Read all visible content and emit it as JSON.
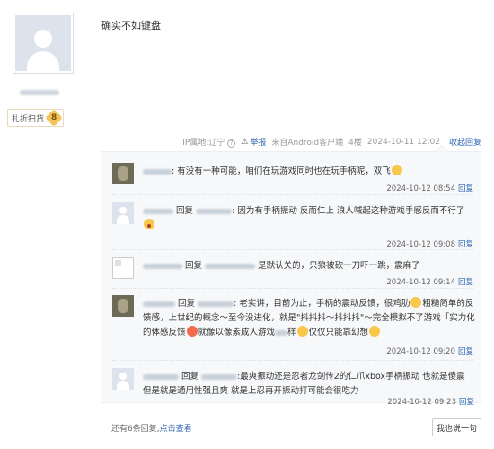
{
  "user": {
    "level_name": "扎折扫货",
    "level_number": "8"
  },
  "post": {
    "text": "确实不如键盘",
    "ip_label": "IP属地:辽宁",
    "report_label": "举报",
    "source_label": "来自Android客户端",
    "floor": "4楼",
    "datetime": "2024-10-11 12:02",
    "collapse_label": "收起回复"
  },
  "replies": [
    {
      "reply_to": "",
      "text": "有没有一种可能，咱们在玩游戏同时也在玩手柄呢，双飞",
      "time": "2024-10-12 08:54",
      "reply_label": "回复"
    },
    {
      "reply_to_prefix": "回复",
      "text": "因为有手柄振动 反而仁上 浪人喊起这种游戏手感反而不行了",
      "time": "2024-10-12 09:08",
      "reply_label": "回复"
    },
    {
      "reply_to_prefix": "回复",
      "text": "是默认关的，只狼被砍一刀吓一跳，震麻了",
      "time": "2024-10-12 09:14",
      "reply_label": "回复"
    },
    {
      "reply_to_prefix": "回复",
      "text_a": "老实讲，目前为止，手柄的震动反馈，很鸡肋",
      "text_b": "粗糙简单的反馈感，上世纪的概念～至今没进化，就是\"抖抖抖～抖抖抖\"～完全模拟不了游戏「实力化的体感反馈",
      "text_c": "就像以像素成人游戏",
      "text_d": "样",
      "text_e": "仅仅只能靠幻想",
      "time": "2024-10-12 09:20",
      "reply_label": "回复"
    },
    {
      "reply_to_prefix": "回复",
      "text": ":最爽振动还是忍者龙剑传2的仁爪xbox手柄振动 也就是傻震 但是就是通用性强且爽 就是上忍再开振动打可能会很吃力",
      "time": "2024-10-12 09:23",
      "reply_label": "回复"
    }
  ],
  "footer": {
    "count_text": "还有6条回复,",
    "view_link": "点击查看",
    "say_button": "我也说一句"
  }
}
